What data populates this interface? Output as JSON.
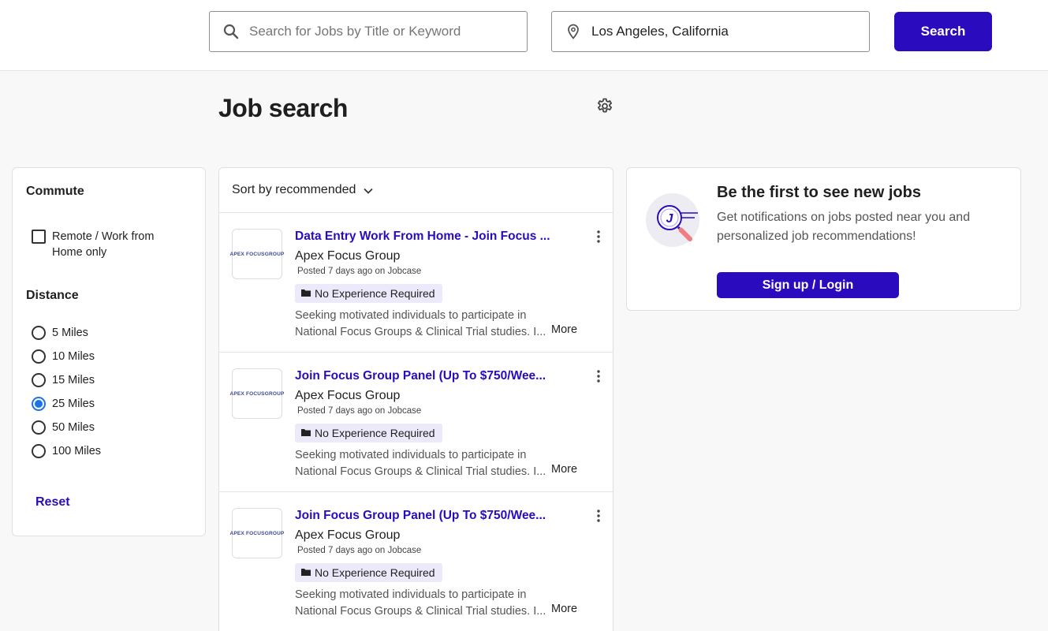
{
  "header": {
    "search_placeholder": "Search for Jobs by Title or Keyword",
    "search_value": "",
    "location_value": "Los Angeles, California",
    "search_button": "Search"
  },
  "page": {
    "title": "Job search"
  },
  "filters": {
    "commute_heading": "Commute",
    "remote_label": "Remote / Work from Home only",
    "remote_checked": false,
    "distance_heading": "Distance",
    "distances": [
      {
        "label": "5 Miles",
        "selected": false
      },
      {
        "label": "10 Miles",
        "selected": false
      },
      {
        "label": "15 Miles",
        "selected": false
      },
      {
        "label": "25 Miles",
        "selected": true
      },
      {
        "label": "50 Miles",
        "selected": false
      },
      {
        "label": "100 Miles",
        "selected": false
      }
    ],
    "reset_label": "Reset"
  },
  "results": {
    "sort_label": "Sort by recommended",
    "more_label": "More",
    "jobs": [
      {
        "title": "Data Entry Work From Home - Join Focus ...",
        "company": "Apex Focus Group",
        "posted": "Posted 7 days ago on Jobcase",
        "badge": "No Experience Required",
        "description": "Seeking motivated individuals to participate in National Focus Groups & Clinical Trial studies. I...",
        "logo_text": "APEX FOCUSGROUP"
      },
      {
        "title": "Join Focus Group Panel (Up To $750/Wee...",
        "company": "Apex Focus Group",
        "posted": "Posted 7 days ago on Jobcase",
        "badge": "No Experience Required",
        "description": "Seeking motivated individuals to participate in National Focus Groups & Clinical Trial studies. I...",
        "logo_text": "APEX FOCUSGROUP"
      },
      {
        "title": "Join Focus Group Panel (Up To $750/Wee...",
        "company": "Apex Focus Group",
        "posted": "Posted 7 days ago on Jobcase",
        "badge": "No Experience Required",
        "description": "Seeking motivated individuals to participate in National Focus Groups & Clinical Trial studies. I...",
        "logo_text": "APEX FOCUSGROUP"
      }
    ]
  },
  "promo": {
    "title": "Be the first to see new jobs",
    "text": "Get notifications on jobs posted near you and personalized job recommendations!",
    "button": "Sign up / Login",
    "illustration_letter": "J"
  },
  "colors": {
    "brand": "#2a0bbd",
    "radio_selected": "#1c73e8",
    "badge_bg": "#ece9fa"
  },
  "icons": [
    "search-icon",
    "location-pin-icon",
    "gear-icon",
    "chevron-down-icon",
    "kebab-menu-icon",
    "folder-icon",
    "magnifier-illustration"
  ]
}
